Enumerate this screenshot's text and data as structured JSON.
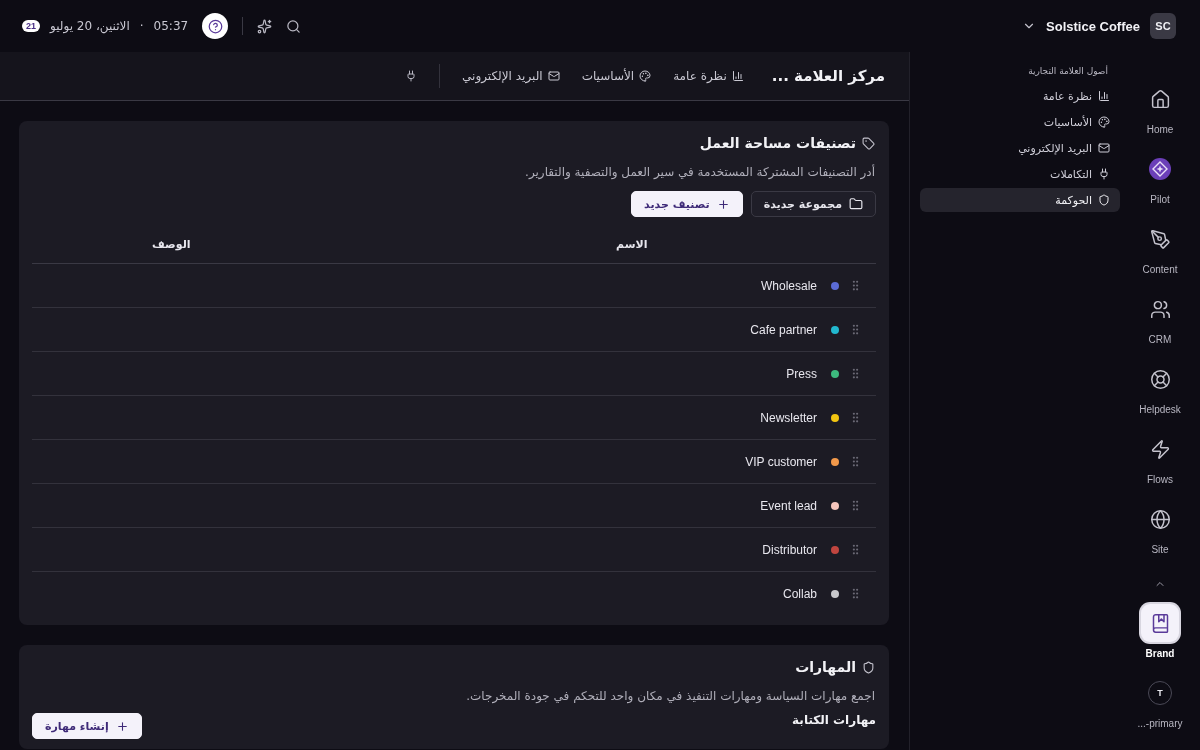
{
  "topbar": {
    "workspace": {
      "initials": "SC",
      "name": "Solstice Coffee"
    },
    "time": "05:37",
    "separator": "·",
    "date": "الاثنين، 20 يوليو",
    "badge": "21"
  },
  "header": {
    "title": "مركز العلامة ...",
    "tabs": [
      {
        "label": "نظرة عامة"
      },
      {
        "label": "الأساسيات"
      },
      {
        "label": "البريد الإلكتروني"
      }
    ]
  },
  "sidebar": {
    "heading": "أصول العلامة التجارية",
    "items": [
      {
        "label": "نظرة عامة",
        "selected": false
      },
      {
        "label": "الأساسيات",
        "selected": false
      },
      {
        "label": "البريد الإلكتروني",
        "selected": false
      },
      {
        "label": "التكاملات",
        "selected": false
      },
      {
        "label": "الحوكمة",
        "selected": true
      }
    ]
  },
  "rail": {
    "items": [
      {
        "kind": "app",
        "label": "Home",
        "selected": false
      },
      {
        "kind": "app",
        "label": "Pilot",
        "selected": false
      },
      {
        "kind": "app",
        "label": "Content",
        "selected": false
      },
      {
        "kind": "app",
        "label": "CRM",
        "selected": false
      },
      {
        "kind": "app",
        "label": "Helpdesk",
        "selected": false
      },
      {
        "kind": "app",
        "label": "Flows",
        "selected": false
      },
      {
        "kind": "app",
        "label": "Site",
        "selected": false
      },
      {
        "kind": "app",
        "label": "Brand",
        "selected": true
      },
      {
        "kind": "account",
        "initial": "T",
        "label": "...-primary",
        "selected": false
      }
    ]
  },
  "tags_card": {
    "title": "تصنيفات مساحة العمل",
    "description": "أدر التصنيفات المشتركة المستخدمة في سير العمل والتصفية والتقارير.",
    "buttons": [
      "مجموعة جديدة",
      "تصنيف جديد"
    ],
    "columns": [
      "الاسم",
      "الوصف"
    ],
    "rows": [
      {
        "name": "Wholesale",
        "color": "#5b6bd6"
      },
      {
        "name": "Cafe partner",
        "color": "#22b8cf"
      },
      {
        "name": "Press",
        "color": "#3dba7e"
      },
      {
        "name": "Newsletter",
        "color": "#f2c511"
      },
      {
        "name": "VIP customer",
        "color": "#f2994a"
      },
      {
        "name": "Event lead",
        "color": "#f5c6bd"
      },
      {
        "name": "Distributor",
        "color": "#c0453f"
      },
      {
        "name": "Collab",
        "color": "#c8c8cc"
      }
    ]
  },
  "skills_card": {
    "title": "المهارات",
    "description": "اجمع مهارات السياسة ومهارات التنفيذ في مكان واحد للتحكم في جودة المخرجات.",
    "section": "مهارات الكتابة",
    "button": "إنشاء مهارة"
  }
}
